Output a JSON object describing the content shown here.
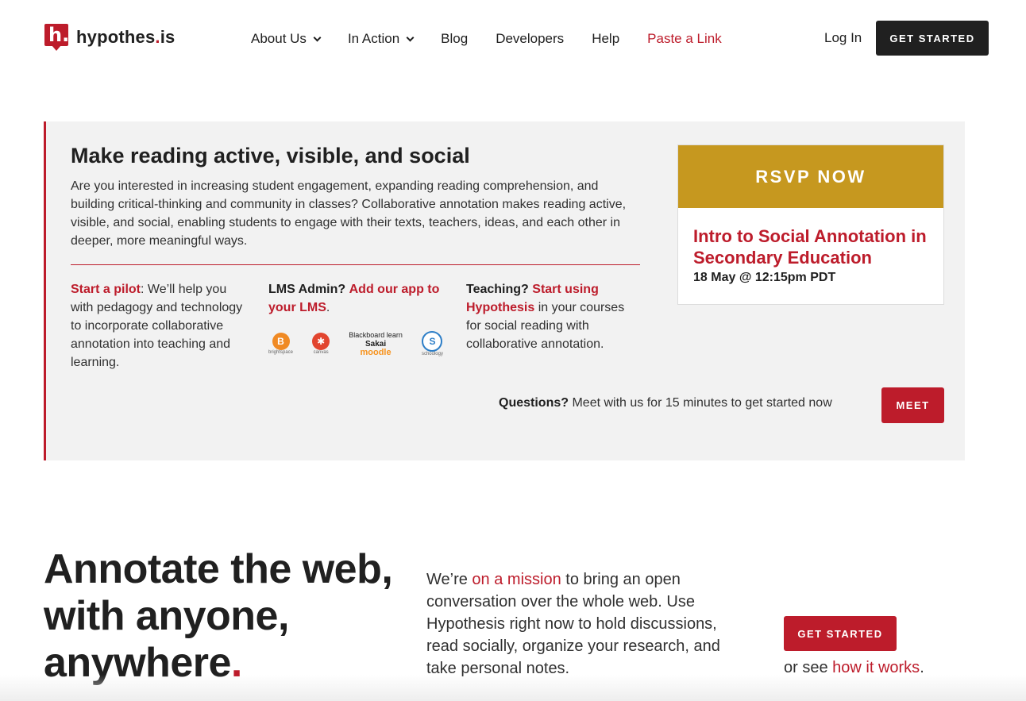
{
  "header": {
    "logo_text_main": "hypothes",
    "logo_text_dot": ".",
    "logo_text_end": "is",
    "logo_mark": "h.",
    "nav": [
      {
        "label": "About Us",
        "has_dropdown": true
      },
      {
        "label": "In Action",
        "has_dropdown": true
      },
      {
        "label": "Blog"
      },
      {
        "label": "Developers"
      },
      {
        "label": "Help"
      },
      {
        "label": "Paste a Link",
        "highlight": true
      }
    ],
    "login_label": "Log In",
    "cta_label": "GET STARTED"
  },
  "promo": {
    "title": "Make reading active, visible, and social",
    "body": "Are you interested in increasing student engagement, expanding reading comprehension, and building critical-thinking and community in classes? Collaborative annotation makes reading active, visible, and social, enabling students to engage with their texts, teachers, ideas, and each other in deeper, more meaningful ways.",
    "col1": {
      "link": "Start a pilot",
      "text": ": We’ll help you with pedagogy and technology to incorporate collaborative annotation into teaching and learning."
    },
    "col2": {
      "lead": "LMS Admin?",
      "link": "Add our app to your LMS",
      "text": "."
    },
    "col3": {
      "lead": "Teaching?",
      "link": "Start using Hypothesis",
      "text": " in your courses for social reading with collaborative annotation."
    },
    "lms_logos": [
      {
        "name": "brightspace",
        "glyph": "B"
      },
      {
        "name": "canvas",
        "glyph": "✱"
      },
      {
        "name": "Blackboard learn",
        "line2": "Sakai",
        "line3": "moodle"
      },
      {
        "name": "schoology",
        "glyph": "S"
      }
    ],
    "question_lead": "Questions?",
    "question_text": "Meet with us for 15 minutes to get started now",
    "meet_label": "MEET",
    "event": {
      "rsvp_label": "RSVP NOW",
      "title": "Intro to Social Annotation in Secondary Education",
      "date": "18 May @ 12:15pm PDT"
    }
  },
  "hero": {
    "title": "Annotate the web, with anyone, anywhere",
    "title_dot": ".",
    "text_pre": "We’re ",
    "text_link": "on a mission",
    "text_post": " to bring an open conversation over the whole web. Use Hypothesis right now to hold discussions, read socially, organize your research, and take personal notes.",
    "cta_label": "GET STARTED",
    "see_pre": "or see ",
    "see_link": "how it works",
    "see_post": "."
  },
  "colors": {
    "brand_red": "#bd1c2b",
    "dark": "#202020",
    "gold": "#c6981f",
    "panel_bg": "#f2f2f2"
  }
}
